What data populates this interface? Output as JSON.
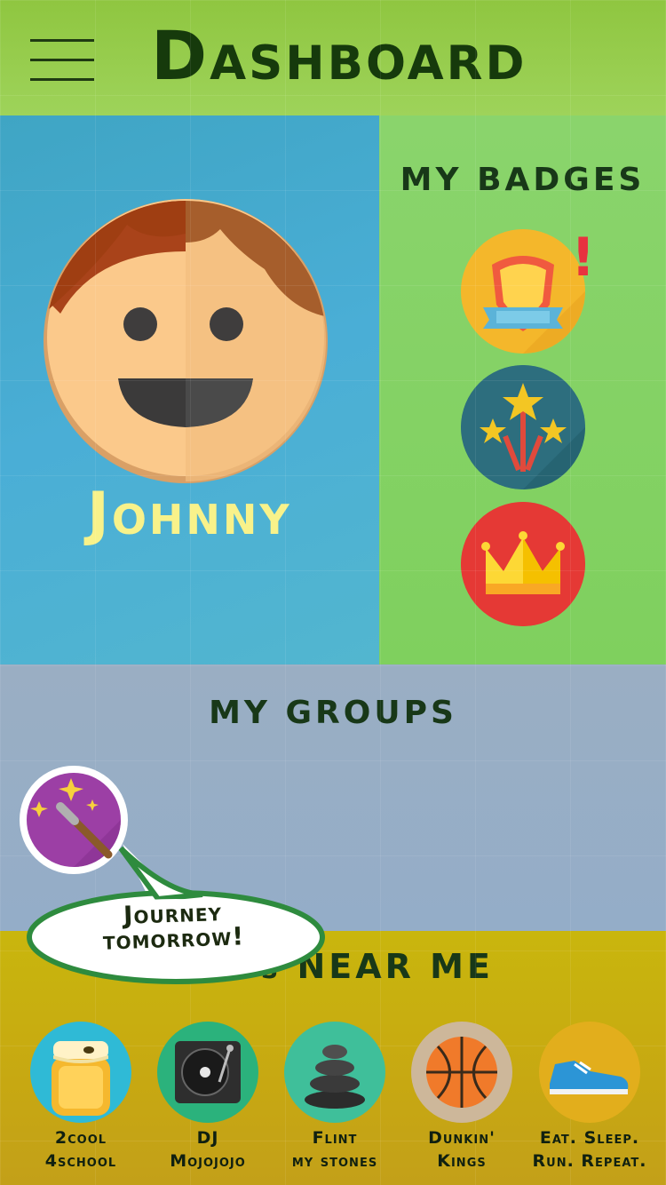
{
  "header": {
    "title": "Dashboard",
    "menu_icon": "hamburger-menu-icon"
  },
  "profile": {
    "name": "Johnny",
    "avatar_icon": "boy-face-avatar"
  },
  "badges": {
    "title": "MY BADGES",
    "items": [
      {
        "icon": "shield-badge-icon",
        "alert": "!"
      },
      {
        "icon": "stars-fireworks-badge-icon"
      },
      {
        "icon": "crown-badge-icon"
      }
    ]
  },
  "groups": {
    "title": "MY GROUPS",
    "items": [
      {
        "icon": "magic-wand-icon",
        "bubble_line1": "Journey",
        "bubble_line2": "tomorrow!"
      }
    ]
  },
  "nearme": {
    "title": "ps NEAR ME",
    "items": [
      {
        "icon": "honey-jar-icon",
        "line1": "2cool",
        "line2": "4school",
        "color": "#2fbad6"
      },
      {
        "icon": "turntable-icon",
        "line1": "DJ",
        "line2": "Mojojojo",
        "color": "#2bb27c"
      },
      {
        "icon": "stacked-stones-icon",
        "line1": "Flint",
        "line2": "my stones",
        "color": "#3fbf9a"
      },
      {
        "icon": "basketball-icon",
        "line1": "Dunkin'",
        "line2": "Kings",
        "color": "#cdb79a"
      },
      {
        "icon": "sneaker-icon",
        "line1": "Eat. Sleep.",
        "line2": "Run. Repeat.",
        "color": "#e2ae1c"
      }
    ]
  },
  "colors": {
    "header": "#8fc640",
    "profile": "#4aaed6",
    "badges": "#80d05f",
    "groups": "#96adc6",
    "nearme": "#c8ad12",
    "name_text": "#f8f28a",
    "title_text": "#163a0c"
  }
}
